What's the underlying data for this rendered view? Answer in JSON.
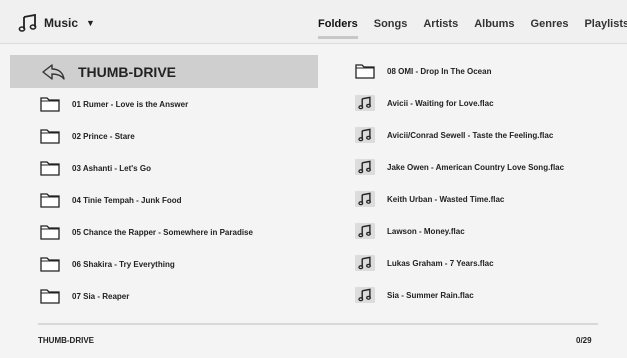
{
  "app": {
    "title": "Music"
  },
  "tabs": [
    {
      "label": "Folders"
    },
    {
      "label": "Songs"
    },
    {
      "label": "Artists"
    },
    {
      "label": "Albums"
    },
    {
      "label": "Genres"
    },
    {
      "label": "Playlists"
    }
  ],
  "current_folder": "THUMB-DRIVE",
  "left_items": [
    {
      "label": "01 Rumer - Love is the Answer",
      "icon": "folder-icon"
    },
    {
      "label": "02 Prince - Stare",
      "icon": "folder-icon"
    },
    {
      "label": "03 Ashanti - Let's Go",
      "icon": "folder-icon"
    },
    {
      "label": "04 Tinie Tempah - Junk Food",
      "icon": "folder-icon"
    },
    {
      "label": "05 Chance the Rapper - Somewhere in Paradise",
      "icon": "folder-icon"
    },
    {
      "label": "06 Shakira - Try Everything",
      "icon": "folder-icon"
    },
    {
      "label": "07 Sia - Reaper",
      "icon": "folder-icon"
    }
  ],
  "right_items": [
    {
      "label": "08 OMI - Drop In The Ocean",
      "icon": "folder-icon"
    },
    {
      "label": "Avicii - Waiting for Love.flac",
      "icon": "music-note-icon"
    },
    {
      "label": "Avicii/Conrad Sewell - Taste the Feeling.flac",
      "icon": "music-note-icon"
    },
    {
      "label": "Jake Owen - American Country Love Song.flac",
      "icon": "music-note-icon"
    },
    {
      "label": "Keith Urban - Wasted Time.flac",
      "icon": "music-note-icon"
    },
    {
      "label": "Lawson - Money.flac",
      "icon": "music-note-icon"
    },
    {
      "label": "Lukas Graham - 7 Years.flac",
      "icon": "music-note-icon"
    },
    {
      "label": "Sia - Summer Rain.flac",
      "icon": "music-note-icon"
    }
  ],
  "footer": {
    "path": "THUMB-DRIVE",
    "count": "0/29"
  }
}
